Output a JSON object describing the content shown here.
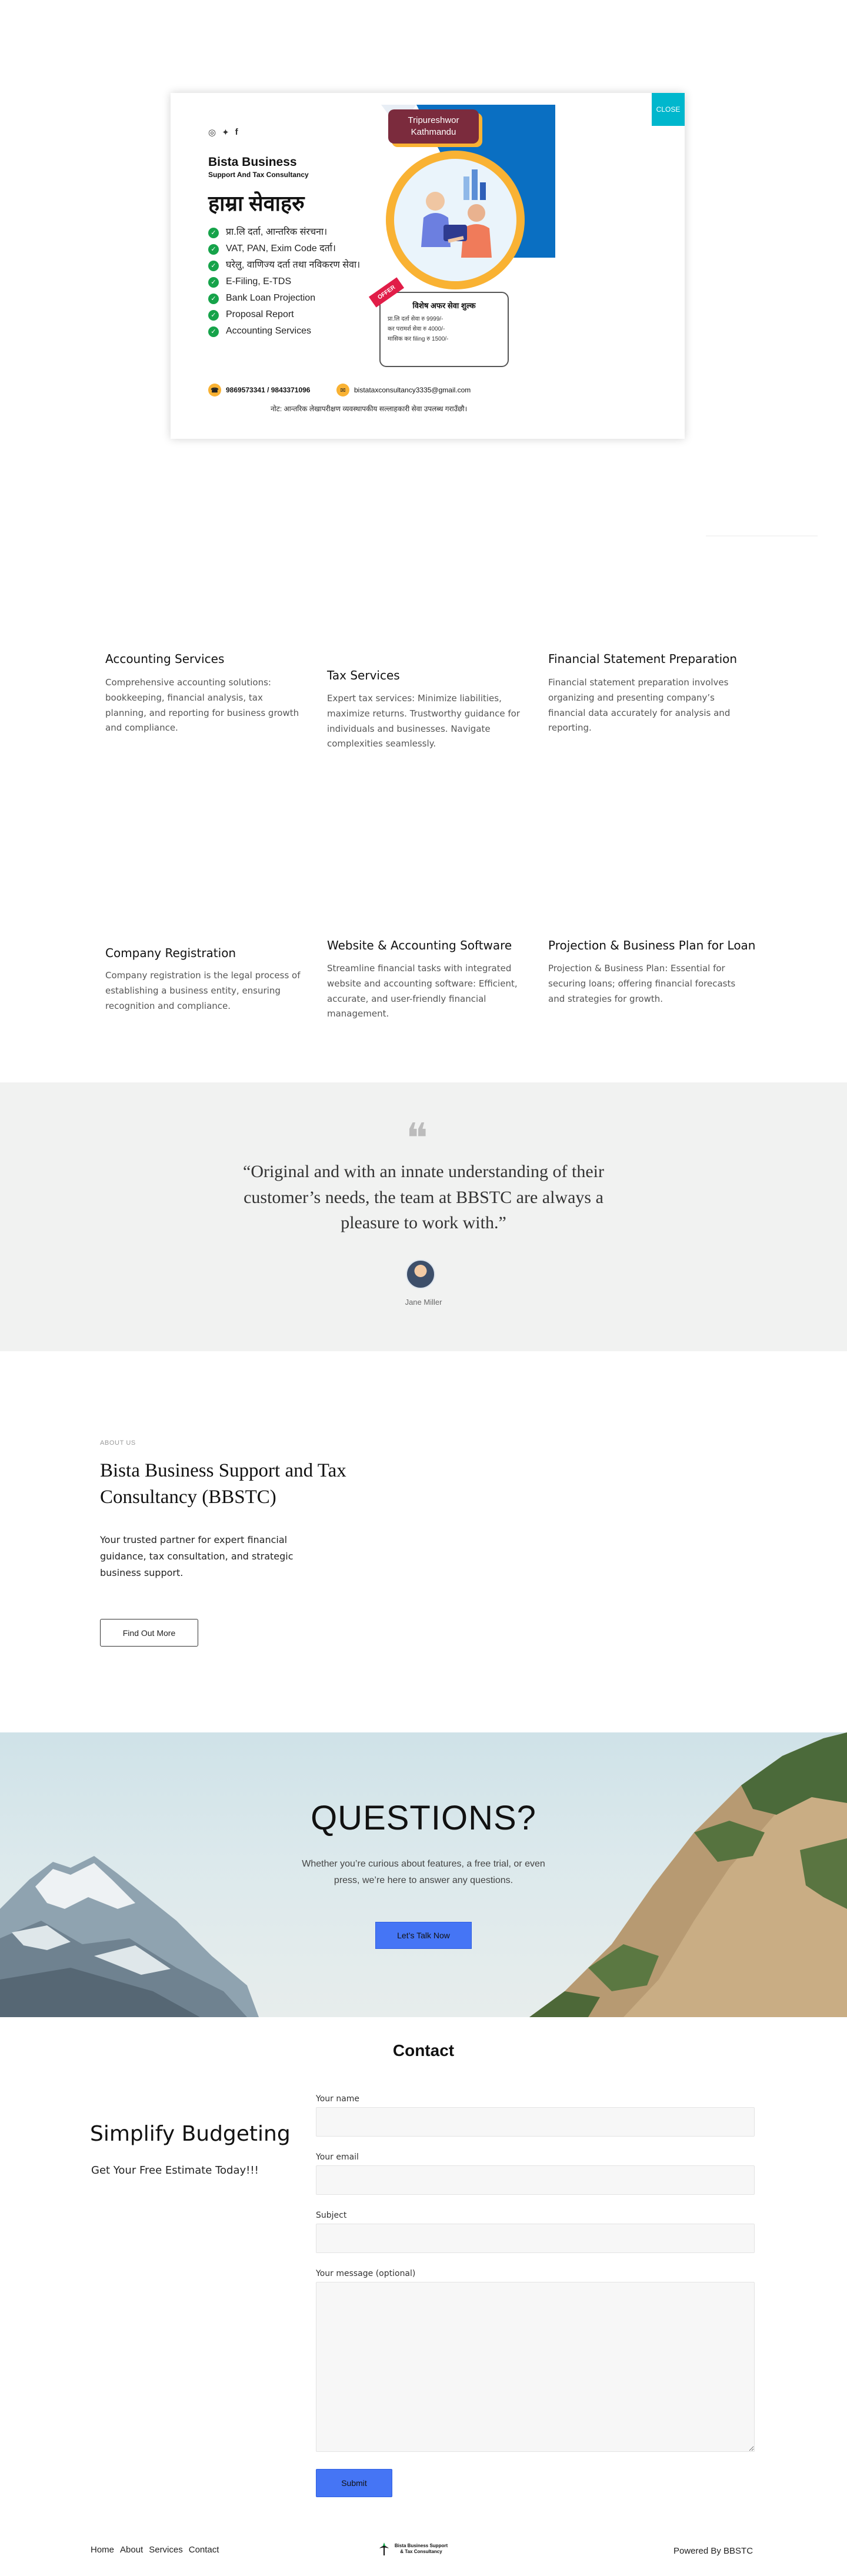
{
  "popup": {
    "close_label": "CLOSE",
    "flyer": {
      "social_icons": [
        "instagram-icon",
        "twitter-icon",
        "facebook-icon"
      ],
      "brand_name": "Bista Business",
      "brand_subtitle": "Support And Tax Consultancy",
      "services_heading": "हाम्रा सेवाहरु",
      "services": [
        "प्रा.लि दर्ता, आन्तरिक संरचना।",
        "VAT, PAN, Exim Code दर्ता।",
        "घरेलु, वाणिज्य दर्ता तथा नविकरण सेवा।",
        "E-Filing, E-TDS",
        "Bank Loan Projection",
        "Proposal Report",
        "Accounting Services"
      ],
      "location_line1": "Tripureshwor",
      "location_line2": "Kathmandu",
      "offer_tag": "OFFER",
      "offer_title": "विशेष अफर सेवा शुल्क",
      "offer_items": [
        "प्रा.लि दर्ता सेवा रु 9999/-",
        "कर परामर्श सेवा रु 4000/-",
        "मासिक कर filing रु 1500/-"
      ],
      "phone": "9869573341 / 9843371096",
      "email": "bistataxconsultancy3335@gmail.com",
      "note": "नोट: आन्तरिक लेखापरीक्षण व्यवस्थापकीय सल्लाहकारी सेवा उपलब्ध गराउँछौ।"
    }
  },
  "services": [
    {
      "title": "Accounting Services",
      "desc": "Comprehensive accounting solutions: bookkeeping, financial analysis, tax planning, and reporting for business growth and compliance."
    },
    {
      "title": "Tax Services",
      "desc": "Expert tax services: Minimize liabilities, maximize returns. Trustworthy guidance for individuals and businesses. Navigate complexities seamlessly."
    },
    {
      "title": "Financial Statement Preparation",
      "desc": "Financial statement preparation involves organizing and presenting company’s financial data accurately for analysis and reporting."
    },
    {
      "title": "Company Registration",
      "desc": "Company registration is the legal process of establishing a business entity, ensuring recognition and compliance."
    },
    {
      "title": "Website & Accounting Software",
      "desc": "Streamline financial tasks with integrated website and accounting software: Efficient, accurate, and user-friendly financial management."
    },
    {
      "title": "Projection & Business Plan for Loan",
      "desc": "Projection & Business Plan: Essential for securing loans; offering financial forecasts and strategies for growth."
    }
  ],
  "testimonial": {
    "quote": "“Original and with an innate understanding of their customer’s needs, the team at BBSTC are always a pleasure to work with.”",
    "name": "Jane Miller"
  },
  "about": {
    "label": "ABOUT US",
    "title": "Bista Business Support and Tax Consultancy (BBSTC)",
    "desc": "Your trusted partner for expert financial guidance, tax consultation, and strategic business support.",
    "button": "Find Out More"
  },
  "questions": {
    "title": "QUESTIONS?",
    "text": "Whether you’re curious about features, a free trial, or even press, we’re here to answer any questions.",
    "button": "Let’s Talk Now"
  },
  "contact": {
    "heading": "Contact",
    "tagline": "Simplify Budgeting",
    "subline": "Get Your Free Estimate Today!!!",
    "name_label": "Your name",
    "email_label": "Your email",
    "subject_label": "Subject",
    "message_label": "Your message (optional)",
    "submit": "Submit"
  },
  "footer": {
    "nav": [
      "Home",
      "About",
      "Services",
      "Contact"
    ],
    "logo_text": "Bista Business Support & Tax Consultancy",
    "powered": "Powered By BBSTC"
  },
  "colors": {
    "accent": "#4575f5",
    "close": "#00b7cd",
    "testimonial_bg": "#f1f2f1",
    "flyer_yellow": "#f9b233",
    "flyer_blue": "#0a6fc2"
  }
}
